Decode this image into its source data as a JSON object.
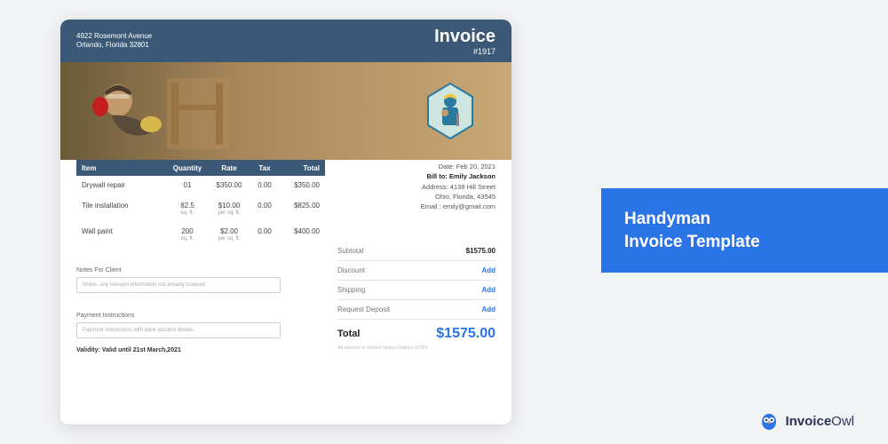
{
  "invoice": {
    "address_l1": "4922 Rosemont Avenue",
    "address_l2": "Orlando, Florida 32801",
    "title": "Invoice",
    "number": "#1917",
    "table": {
      "headers": {
        "item": "Item",
        "qty": "Quantity",
        "rate": "Rate",
        "tax": "Tax",
        "total": "Total"
      },
      "rows": [
        {
          "item": "Drywall repair",
          "qty": "01",
          "qty_unit": "",
          "rate": "$350.00",
          "rate_unit": "",
          "tax": "0.00",
          "total": "$350.00"
        },
        {
          "item": "Tile installation",
          "qty": "82.5",
          "qty_unit": "sq. ft.",
          "rate": "$10.00",
          "rate_unit": "per sq. ft.",
          "tax": "0.00",
          "total": "$825.00"
        },
        {
          "item": "Wall paint",
          "qty": "200",
          "qty_unit": "sq. ft.",
          "rate": "$2.00",
          "rate_unit": "per sq. ft.",
          "tax": "0.00",
          "total": "$400.00"
        }
      ]
    },
    "notes_label": "Notes For Client",
    "notes_placeholder": "Notes- any relevant information not already covered.",
    "payment_label": "Payment Instructions",
    "payment_placeholder": "Payment instructions with bank account details.",
    "validity": "Validity: Valid until 21st March,2021",
    "bill": {
      "date_label": "Date:",
      "date": "Feb 20, 2021",
      "to_label": "Bill to:",
      "to": "Emily Jackson",
      "addr_label": "Address:",
      "addr1": "4138 Hill Street",
      "addr2": "Ohio, Florida, 43545",
      "email_label": "Email :",
      "email": "emily@gmail.com"
    },
    "summary": {
      "subtotal_label": "Subtotal",
      "subtotal": "$1575.00",
      "discount_label": "Discount",
      "shipping_label": "Shipping",
      "deposit_label": "Request Deposit",
      "add": "Add",
      "total_label": "Total",
      "total": "$1575.00",
      "disclaimer": "All amount in United States Dollars (USD)"
    }
  },
  "promo": {
    "line1": "Handyman",
    "line2": "Invoice Template"
  },
  "brand": {
    "name_1": "Invoice",
    "name_2": "Owl"
  }
}
